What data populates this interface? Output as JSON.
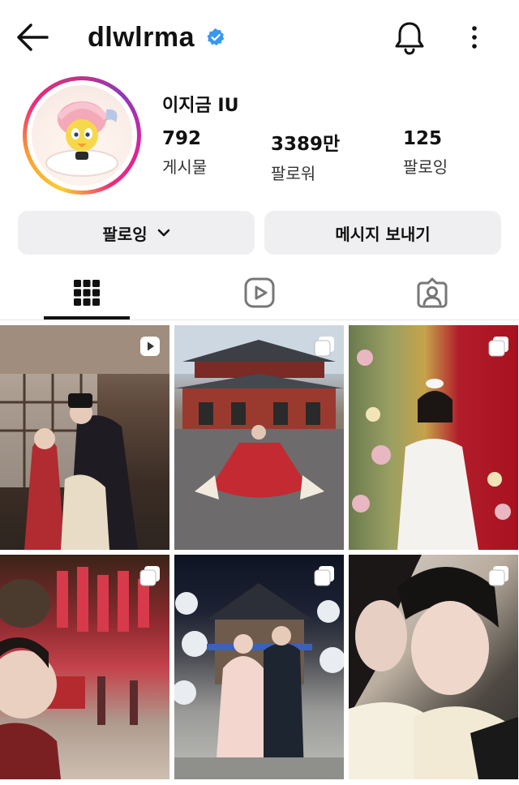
{
  "header": {
    "username": "dlwlrma",
    "verified": true,
    "icons": {
      "back": "back-arrow-icon",
      "notifications": "bell-icon",
      "more": "more-vertical-icon"
    }
  },
  "profile": {
    "full_name": "이지금 IU",
    "stats": [
      {
        "value": "792",
        "label": "게시물"
      },
      {
        "value": "3389만",
        "label": "팔로워"
      },
      {
        "value": "125",
        "label": "팔로잉"
      }
    ]
  },
  "actions": {
    "following_label": "팔로잉",
    "message_label": "메시지 보내기"
  },
  "tabs": [
    {
      "name": "posts",
      "icon": "grid-icon",
      "active": true
    },
    {
      "name": "reels",
      "icon": "reels-icon",
      "active": false
    },
    {
      "name": "tagged",
      "icon": "tagged-icon",
      "active": false
    }
  ],
  "posts": [
    {
      "type": "reel",
      "badge_icon": "reel-play-icon"
    },
    {
      "type": "carousel",
      "badge_icon": "carousel-icon"
    },
    {
      "type": "carousel",
      "badge_icon": "carousel-icon"
    },
    {
      "type": "carousel",
      "badge_icon": "carousel-icon"
    },
    {
      "type": "carousel",
      "badge_icon": "carousel-icon"
    },
    {
      "type": "carousel",
      "badge_icon": "carousel-icon"
    }
  ],
  "colors": {
    "text": "#111111",
    "button_bg": "#efeff1",
    "verified_blue": "#3897f0"
  }
}
